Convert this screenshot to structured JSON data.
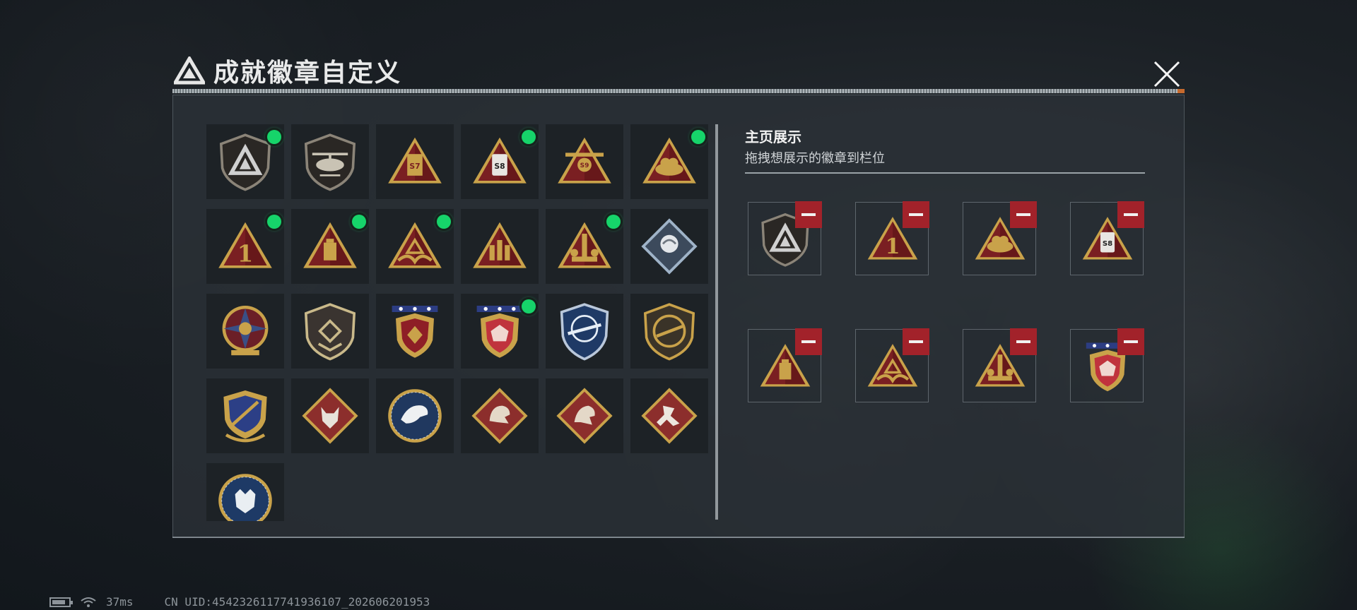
{
  "header": {
    "title": "成就徽章自定义"
  },
  "display": {
    "title": "主页展示",
    "subtitle": "拖拽想展示的徽章到栏位"
  },
  "status": {
    "ping": "37ms",
    "uid": "CN UID:4542326117741936107_202606201953"
  },
  "colors": {
    "accent_green": "#16d46a",
    "remove_red": "#a2222a",
    "badge_red": "#7a1f22",
    "badge_gold": "#c9a24a"
  },
  "badges": [
    {
      "icon": "shield-a-icon",
      "equipped": true
    },
    {
      "icon": "helicopter-icon",
      "equipped": false
    },
    {
      "icon": "triangle-s7-icon",
      "equipped": false
    },
    {
      "icon": "triangle-s8-icon",
      "equipped": true
    },
    {
      "icon": "triangle-s9-wings-icon",
      "equipped": false
    },
    {
      "icon": "triangle-pile-icon",
      "equipped": true
    },
    {
      "icon": "triangle-1-icon",
      "equipped": true
    },
    {
      "icon": "triangle-cup-icon",
      "equipped": true
    },
    {
      "icon": "triangle-hands-icon",
      "equipped": true
    },
    {
      "icon": "triangle-soldiers-icon",
      "equipped": false
    },
    {
      "icon": "triangle-tower-icon",
      "equipped": true
    },
    {
      "icon": "diamond-rose-icon",
      "equipped": false
    },
    {
      "icon": "star-emblem-icon",
      "equipped": false
    },
    {
      "icon": "shield-wings-icon",
      "equipped": false
    },
    {
      "icon": "stars-shield-gold-icon",
      "equipped": false
    },
    {
      "icon": "stars-shield-red-icon",
      "equipped": true
    },
    {
      "icon": "shield-crosshair-rifle-icon",
      "equipped": false
    },
    {
      "icon": "shield-rifle-icon",
      "equipped": false
    },
    {
      "icon": "shield-sword-laurel-icon",
      "equipped": false
    },
    {
      "icon": "diamond-wolf-icon",
      "equipped": false
    },
    {
      "icon": "circle-eagle-icon",
      "equipped": false
    },
    {
      "icon": "diamond-dragon-icon",
      "equipped": false
    },
    {
      "icon": "diamond-dragon-2-icon",
      "equipped": false
    },
    {
      "icon": "diamond-runner-icon",
      "equipped": false
    },
    {
      "icon": "circle-lynx-icon",
      "equipped": false
    }
  ],
  "slots": [
    {
      "icon": "shield-a-icon"
    },
    {
      "icon": "triangle-1-icon"
    },
    {
      "icon": "triangle-pile-icon"
    },
    {
      "icon": "triangle-s8-icon"
    },
    {
      "icon": "triangle-cup-icon"
    },
    {
      "icon": "triangle-hands-icon"
    },
    {
      "icon": "triangle-tower-icon"
    },
    {
      "icon": "stars-shield-red-icon"
    }
  ],
  "badge_texts": {
    "s7": "S7",
    "s8": "S8",
    "s9": "S9",
    "one": "1"
  }
}
